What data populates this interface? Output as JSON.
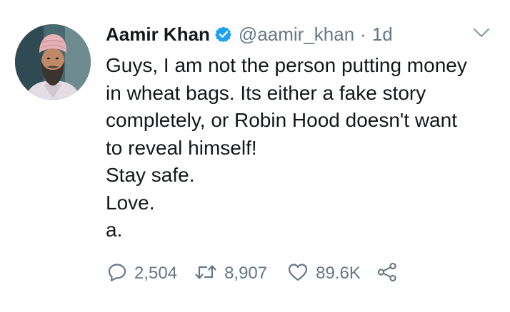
{
  "tweet": {
    "author": {
      "name": "Aamir Khan",
      "handle": "@aamir_khan",
      "verified": true,
      "avatar_icon": "profile-photo"
    },
    "separator": "·",
    "time": "1d",
    "menu_icon": "chevron-down-icon",
    "text_lines": [
      "Guys, I am not the person putting money",
      "in wheat bags. Its either a fake story",
      "completely, or Robin Hood doesn't want",
      "to reveal himself!",
      "Stay safe.",
      "Love.",
      "a."
    ],
    "actions": {
      "reply_count": "2,504",
      "retweet_count": "8,907",
      "like_count": "89.6K"
    }
  },
  "colors": {
    "text": "#14171a",
    "secondary": "#657786",
    "verified_blue": "#1da1f2",
    "background": "#ffffff"
  }
}
